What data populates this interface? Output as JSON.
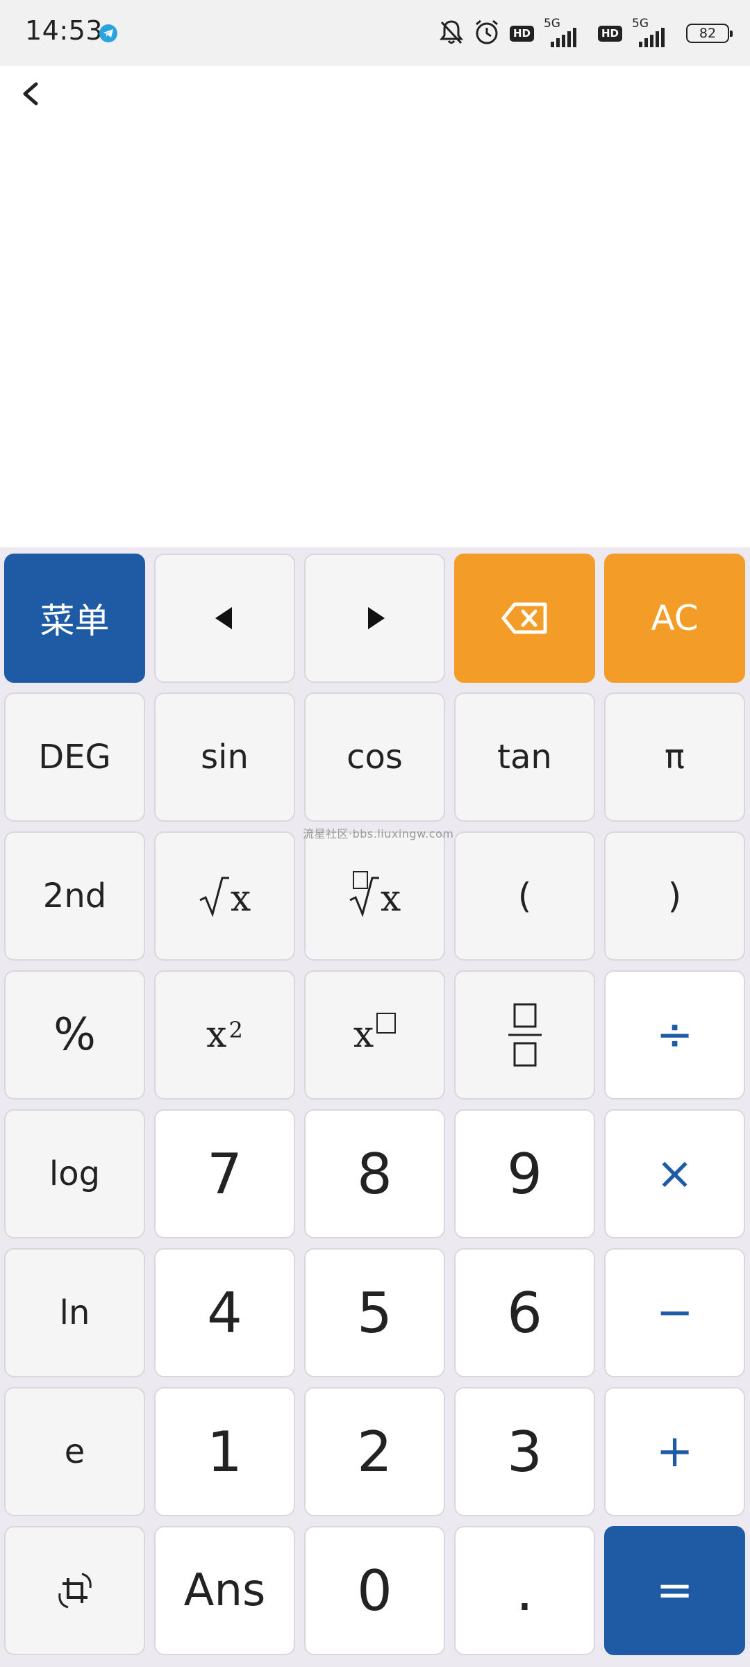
{
  "status_bar": {
    "time": "14:53",
    "hd_label": "HD",
    "network_label": "5G",
    "battery_level": "82",
    "battery_fraction": 0.82
  },
  "display": {
    "expression": "",
    "result": ""
  },
  "watermark": "流星社区·bbs.liuxingw.com",
  "keys": {
    "menu": "菜单",
    "ac": "AC",
    "deg": "DEG",
    "sin": "sin",
    "cos": "cos",
    "tan": "tan",
    "pi": "π",
    "second": "2nd",
    "open_paren": "(",
    "close_paren": ")",
    "percent": "%",
    "square_base": "x",
    "square_exp": "2",
    "power_base": "x",
    "sqrt_arg": "x",
    "root_arg": "x",
    "divide": "÷",
    "log": "log",
    "seven": "7",
    "eight": "8",
    "nine": "9",
    "multiply": "×",
    "ln": "ln",
    "four": "4",
    "five": "5",
    "six": "6",
    "minus": "−",
    "e": "e",
    "one": "1",
    "two": "2",
    "three": "3",
    "plus": "+",
    "ans": "Ans",
    "zero": "0",
    "dot": ".",
    "equals": "="
  },
  "colors": {
    "primary_blue": "#1f5ba5",
    "orange": "#f39c27",
    "key_gray": "#f5f5f5",
    "key_white": "#ffffff"
  }
}
